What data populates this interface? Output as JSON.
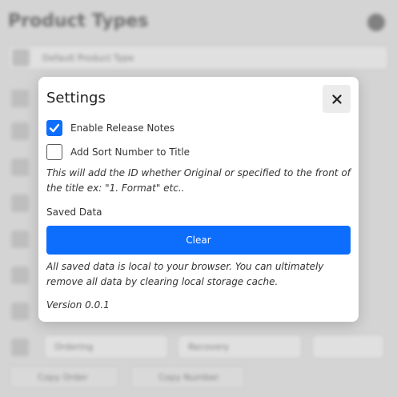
{
  "background": {
    "page_title": "Product Types",
    "default_label": "Default Product Type",
    "row_field_a": "Ordering",
    "row_field_b": "Recovery",
    "button_a": "Copy Order",
    "button_b": "Copy Number"
  },
  "modal": {
    "title": "Settings",
    "close_icon": "close-icon",
    "options": [
      {
        "label": "Enable Release Notes",
        "checked": true
      },
      {
        "label": "Add Sort Number to Title",
        "checked": false
      }
    ],
    "sort_note": "This will add the ID whether Original or specified to the front of the title ex: \"1. Format\" etc..",
    "saved_data_label": "Saved Data",
    "clear_button": "Clear",
    "storage_note": "All saved data is local to your browser. You can ultimately remove all data by clearing local storage cache.",
    "version": "Version 0.0.1"
  },
  "colors": {
    "accent": "#0d6efd"
  }
}
